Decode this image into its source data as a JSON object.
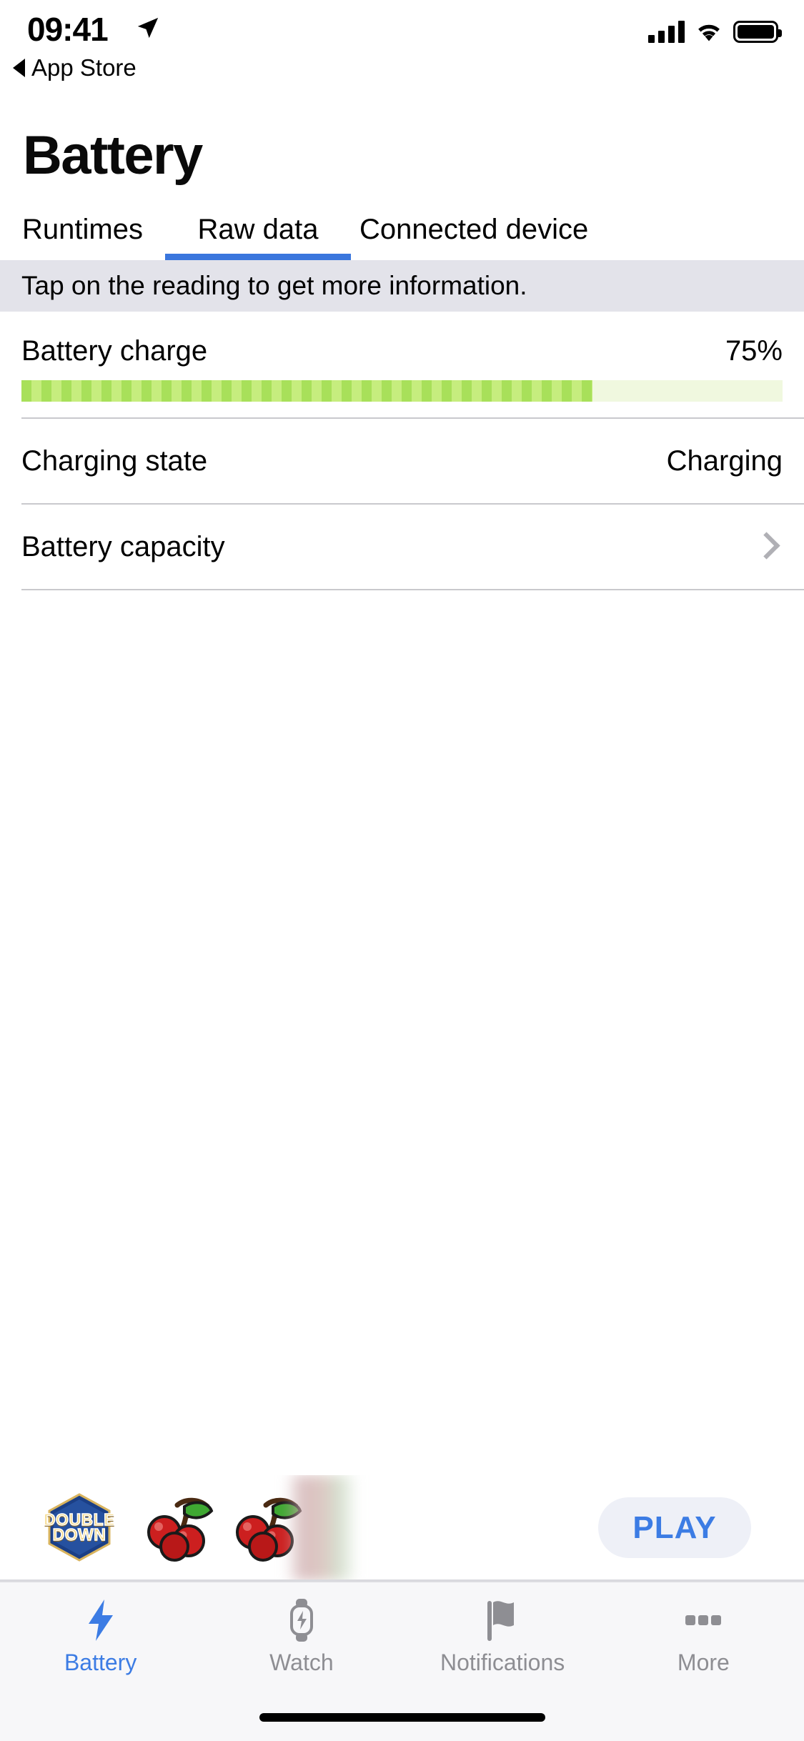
{
  "status_bar": {
    "time": "09:41",
    "back_label": "App Store",
    "location_icon": "location-arrow-icon",
    "cellular_icon": "cellular-bars-icon",
    "wifi_icon": "wifi-icon",
    "battery_icon": "battery-full-icon"
  },
  "header": {
    "title": "Battery"
  },
  "tabs": {
    "items": [
      {
        "label": "Runtimes",
        "active": false
      },
      {
        "label": "Raw data",
        "active": true
      },
      {
        "label": "Connected device",
        "active": false
      }
    ],
    "active_color": "#3a76dd"
  },
  "hint": {
    "text": "Tap on the reading to get more information.",
    "background": "#e3e3ea"
  },
  "readings": {
    "charge": {
      "label": "Battery charge",
      "value": "75%",
      "percent": 75,
      "fill_color": "#a8e05a",
      "track_color": "#f0f8df"
    },
    "charging_state": {
      "label": "Charging state",
      "value": "Charging"
    },
    "capacity": {
      "label": "Battery capacity",
      "disclosure_icon": "chevron-right-icon"
    }
  },
  "ad": {
    "logo_line1": "DOUBLE",
    "logo_line2": "DOWN",
    "cherry_icon": "cherries-icon",
    "play_label": "PLAY",
    "play_color": "#3c7ce4",
    "play_background": "#eef0f7"
  },
  "bottom_tabs": {
    "items": [
      {
        "label": "Battery",
        "icon": "lightning-bolt-icon",
        "active": true
      },
      {
        "label": "Watch",
        "icon": "watch-icon",
        "active": false
      },
      {
        "label": "Notifications",
        "icon": "flag-icon",
        "active": false
      },
      {
        "label": "More",
        "icon": "ellipsis-icon",
        "active": false
      }
    ],
    "active_color": "#3c7ce4",
    "inactive_color": "#8e8e93"
  }
}
